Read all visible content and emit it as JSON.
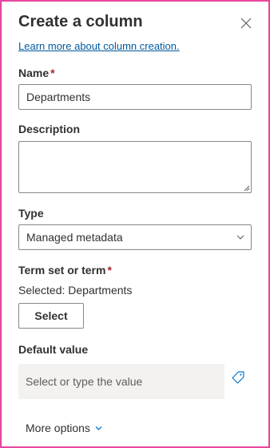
{
  "panel": {
    "title": "Create a column",
    "learn_more": "Learn more about column creation."
  },
  "fields": {
    "name": {
      "label": "Name",
      "required_mark": "*",
      "value": "Departments"
    },
    "description": {
      "label": "Description",
      "value": ""
    },
    "type": {
      "label": "Type",
      "selected": "Managed metadata"
    },
    "term_set": {
      "label": "Term set or term",
      "required_mark": "*",
      "selected_text": "Selected: Departments",
      "button_label": "Select"
    },
    "default_value": {
      "label": "Default value",
      "placeholder": "Select or type the value"
    }
  },
  "footer": {
    "more_options": "More options"
  },
  "colors": {
    "link": "#005a9e",
    "required": "#a4262c",
    "frame": "#e8479f",
    "input_bg": "#f3f2f1"
  },
  "icons": {
    "close": "close-icon",
    "dropdown": "chevron-down-icon",
    "tag": "tag-icon",
    "more": "chevron-down-icon"
  }
}
